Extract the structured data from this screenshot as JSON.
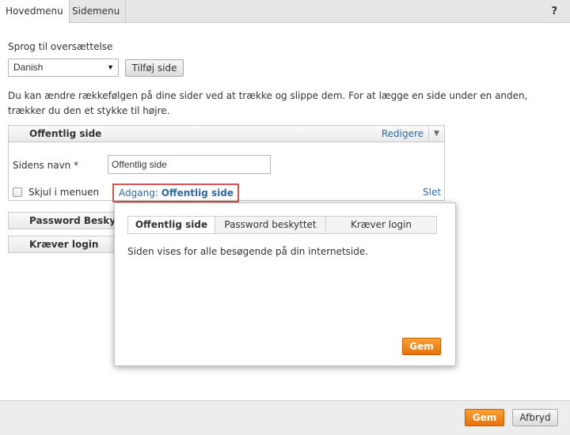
{
  "tabs": [
    "Hovedmenu",
    "Sidemenu"
  ],
  "help_label": "?",
  "language": {
    "label": "Sprog til oversættelse",
    "selected": "Danish",
    "add_page_button": "Tilføj side"
  },
  "info_text": "Du kan ændre rækkefølgen på dine sider ved at trække og slippe dem. For at lægge en side under en anden, trækker du den et stykke til højre.",
  "pages": [
    {
      "title": "Offentlig side",
      "edit_label": "Redigere",
      "name_label": "Sidens navn *",
      "name_value": "Offentlig side",
      "hide_label": "Skjul i menuen",
      "access_prefix": "Adgang:",
      "access_value": "Offentlig side",
      "delete_label": "Slet"
    },
    {
      "title": "Password Beskyt"
    },
    {
      "title": "Kræver login"
    }
  ],
  "popup": {
    "tabs": [
      "Offentlig side",
      "Password beskyttet",
      "Kræver login"
    ],
    "active_tab": "Offentlig side",
    "description": "Siden vises for alle besøgende på din internetside.",
    "save_button": "Gem"
  },
  "footer": {
    "save_button": "Gem",
    "cancel_button": "Afbryd"
  },
  "colors": {
    "link": "#2e6aa6",
    "accent_orange": "#f28a1d",
    "highlight_red": "#d9534f"
  }
}
